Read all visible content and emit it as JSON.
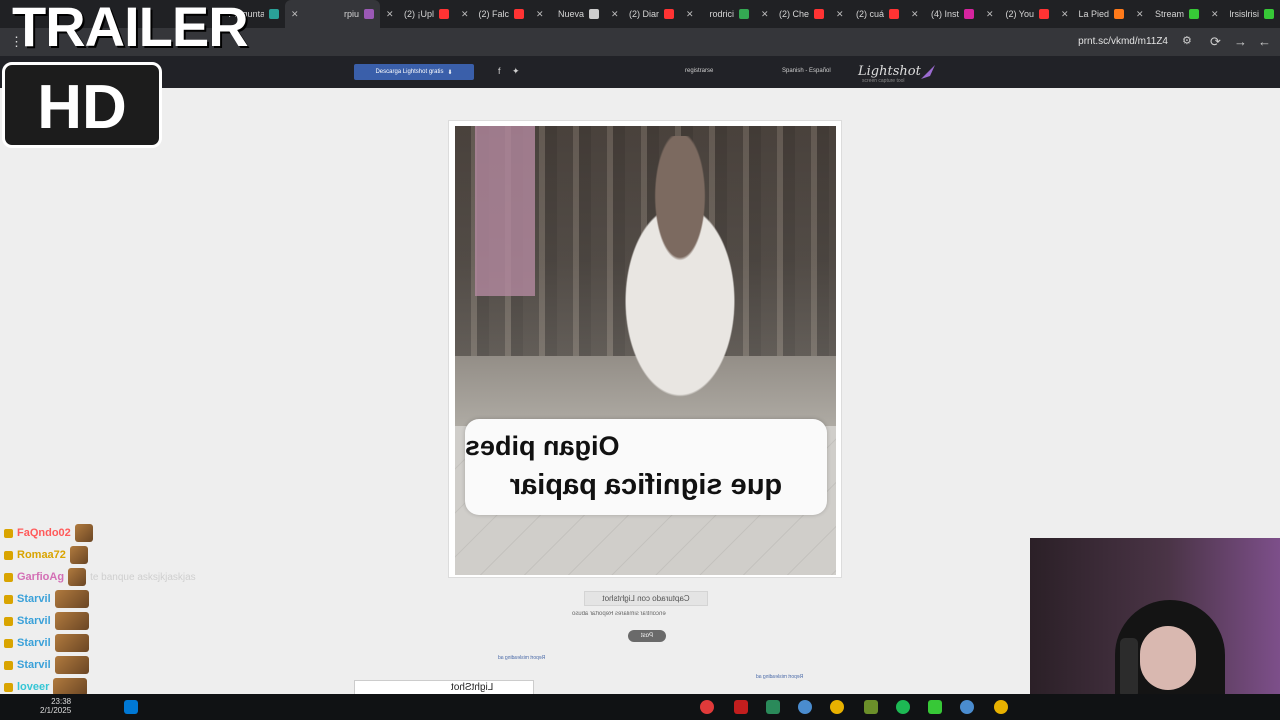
{
  "overlay": {
    "trailer": "TRAILER",
    "hd": "HD"
  },
  "browser": {
    "tabs": [
      {
        "label": "lrsislrisi",
        "color": "#37c837"
      },
      {
        "label": "Stream",
        "color": "#37c837"
      },
      {
        "label": "La Pied",
        "color": "#ff7a1a"
      },
      {
        "label": "(2) You",
        "color": "#ff3333"
      },
      {
        "label": "(4) Inst",
        "color": "#d6249f"
      },
      {
        "label": "(2) cuá",
        "color": "#ff3333"
      },
      {
        "label": "(2) Che",
        "color": "#ff3333"
      },
      {
        "label": "rodrici",
        "color": "#34a853"
      },
      {
        "label": "(2) Diar",
        "color": "#ff3333"
      },
      {
        "label": "Nueva",
        "color": "#cccccc"
      },
      {
        "label": "(2) Falc",
        "color": "#ff3333"
      },
      {
        "label": "(2) ¡Upl",
        "color": "#ff3333"
      },
      {
        "label": "rpiu",
        "color": "#9b59b6",
        "active": true
      },
      {
        "label": "Pregunta cuán",
        "color": "#2aa198"
      }
    ],
    "url": "prnt.sc/vkmd/m11Z4"
  },
  "site": {
    "logo": "Lightshot",
    "logo_sub": "screen capture tool",
    "language": "Spanish - Español",
    "register": "registrarse",
    "download": "Descarga Lightshot gratis",
    "captured": "Capturado con Lightshot",
    "links": "encontrar similares   Reportar abuso",
    "post": "Post",
    "report_ad": "Report misleading ad",
    "ad_title": "LightShot"
  },
  "image": {
    "line1": "Oigan pibes",
    "line2": "que significa papiar"
  },
  "chat": [
    {
      "user": "FaQndo02",
      "color": "#ff5a5a",
      "msg": ""
    },
    {
      "user": "Romaa72",
      "color": "#d9a400",
      "msg": ""
    },
    {
      "user": "GarfioAg",
      "color": "#d36fb5",
      "msg": "te banque asksjkjaskjas"
    },
    {
      "user": "Starvil",
      "color": "#3aa1d9",
      "msg": ""
    },
    {
      "user": "Starvil",
      "color": "#3aa1d9",
      "msg": ""
    },
    {
      "user": "Starvil",
      "color": "#3aa1d9",
      "msg": ""
    },
    {
      "user": "Starvil",
      "color": "#3aa1d9",
      "msg": ""
    },
    {
      "user": "loveer",
      "color": "#35c6d5",
      "msg": ""
    }
  ],
  "taskbar": {
    "time": "23:38",
    "date": "2/1/2025"
  }
}
